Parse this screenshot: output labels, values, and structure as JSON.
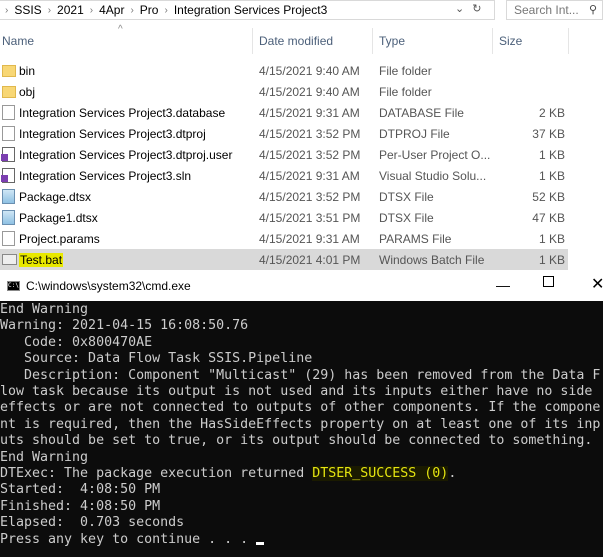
{
  "explorer": {
    "breadcrumb": [
      "SSIS",
      "2021",
      "4Apr",
      "Pro",
      "Integration Services Project3"
    ],
    "search_placeholder": "Search Int...",
    "columns": {
      "name": "Name",
      "date": "Date modified",
      "type": "Type",
      "size": "Size"
    },
    "files": [
      {
        "name": "bin",
        "date": "4/15/2021 9:40 AM",
        "type": "File folder",
        "size": "",
        "icon": "folder-icon"
      },
      {
        "name": "obj",
        "date": "4/15/2021 9:40 AM",
        "type": "File folder",
        "size": "",
        "icon": "folder-icon"
      },
      {
        "name": "Integration Services Project3.database",
        "date": "4/15/2021 9:31 AM",
        "type": "DATABASE File",
        "size": "2 KB",
        "icon": "file-icon"
      },
      {
        "name": "Integration Services Project3.dtproj",
        "date": "4/15/2021 3:52 PM",
        "type": "DTPROJ File",
        "size": "37 KB",
        "icon": "file-icon"
      },
      {
        "name": "Integration Services Project3.dtproj.user",
        "date": "4/15/2021 3:52 PM",
        "type": "Per-User Project O...",
        "size": "1 KB",
        "icon": "vs-user-icon"
      },
      {
        "name": "Integration Services Project3.sln",
        "date": "4/15/2021 9:31 AM",
        "type": "Visual Studio Solu...",
        "size": "1 KB",
        "icon": "vs-solution-icon"
      },
      {
        "name": "Package.dtsx",
        "date": "4/15/2021 3:52 PM",
        "type": "DTSX File",
        "size": "52 KB",
        "icon": "dtsx-icon"
      },
      {
        "name": "Package1.dtsx",
        "date": "4/15/2021 3:51 PM",
        "type": "DTSX File",
        "size": "47 KB",
        "icon": "dtsx-icon"
      },
      {
        "name": "Project.params",
        "date": "4/15/2021 9:31 AM",
        "type": "PARAMS File",
        "size": "1 KB",
        "icon": "file-icon"
      },
      {
        "name": "Test.bat",
        "date": "4/15/2021 4:01 PM",
        "type": "Windows Batch File",
        "size": "1 KB",
        "icon": "batch-icon",
        "selected": true,
        "highlight": "#e8e800"
      }
    ]
  },
  "cmd": {
    "title": "C:\\windows\\system32\\cmd.exe",
    "lines": [
      "End Warning",
      "Warning: 2021-04-15 16:08:50.76",
      "   Code: 0x800470AE",
      "   Source: Data Flow Task SSIS.Pipeline",
      "   Description: Component \"Multicast\" (29) has been removed from the Data F",
      "low task because its output is not used and its inputs either have no side",
      "effects or are not connected to outputs of other components. If the compone",
      "nt is required, then the HasSideEffects property on at least one of its inp",
      "uts should be set to true, or its output should be connected to something.",
      "End Warning"
    ],
    "result_prefix": "DTExec: The package execution returned ",
    "result_code": "DTSER_SUCCESS (0)",
    "result_suffix": ".",
    "tail": [
      "Started:  4:08:50 PM",
      "Finished: 4:08:50 PM",
      "Elapsed:  0.703 seconds",
      "Press any key to continue . . . "
    ],
    "colors": {
      "background": "#0c0c0c",
      "text": "#cccccc",
      "success": "#e5e510"
    }
  }
}
